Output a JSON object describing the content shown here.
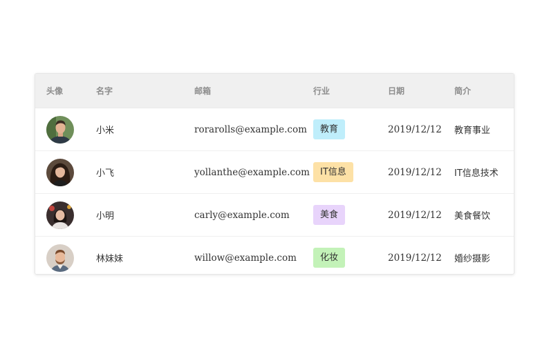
{
  "table": {
    "columns": [
      "头像",
      "名字",
      "邮箱",
      "行业",
      "日期",
      "简介"
    ],
    "rows": [
      {
        "avatar_icon": "person-avatar-man-short-hair",
        "name": "小米",
        "email": "rorarolls@example.com",
        "industry": "教育",
        "industry_color": "#bfeefb",
        "date": "2019/12/12",
        "intro": "教育事业"
      },
      {
        "avatar_icon": "person-avatar-woman-long-hair",
        "name": "小飞",
        "email": "yollanthe@example.com",
        "industry": "IT信息",
        "industry_color": "#fde1a6",
        "date": "2019/12/12",
        "intro": "IT信息技术"
      },
      {
        "avatar_icon": "person-avatar-woman-dark-hair",
        "name": "小明",
        "email": "carly@example.com",
        "industry": "美食",
        "industry_color": "#e8d4fb",
        "date": "2019/12/12",
        "intro": "美食餐饮"
      },
      {
        "avatar_icon": "person-avatar-man-beard",
        "name": "林妹妹",
        "email": "willow@example.com",
        "industry": "化妆",
        "industry_color": "#c3f2b8",
        "date": "2019/12/12",
        "intro": "婚纱摄影"
      }
    ]
  }
}
